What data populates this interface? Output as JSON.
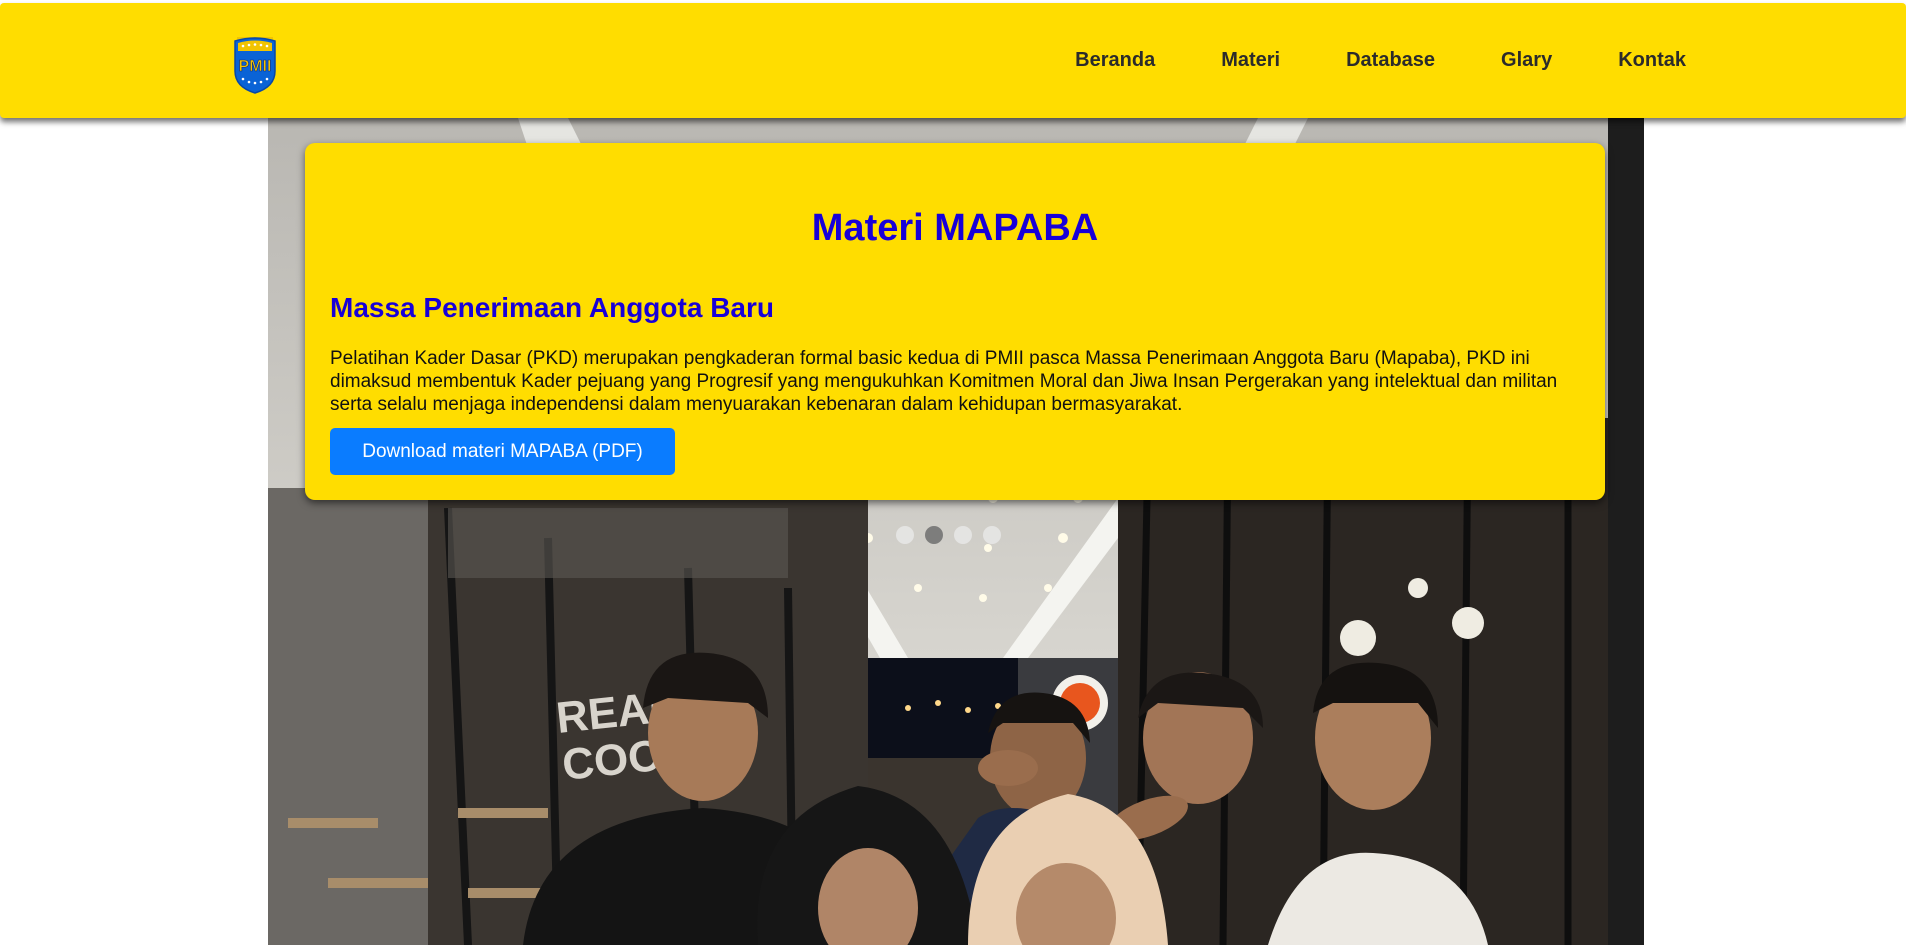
{
  "header": {
    "logo": {
      "text": "PMII",
      "icon": "pmii-shield-logo-icon",
      "color": "#0a63d6"
    },
    "nav": [
      {
        "label": "Beranda"
      },
      {
        "label": "Materi"
      },
      {
        "label": "Database"
      },
      {
        "label": "Glary"
      },
      {
        "label": "Kontak"
      }
    ]
  },
  "card": {
    "title": "Materi MAPABA",
    "subtitle": "Massa Penerimaan Anggota Baru",
    "description": "Pelatihan Kader Dasar (PKD) merupakan pengkaderan formal basic kedua di PMII pasca Massa Penerimaan Anggota Baru (Mapaba), PKD ini dimaksud membentuk Kader pejuang yang Progresif yang mengukuhkan Komitmen Moral dan Jiwa Insan Pergerakan yang intelektual dan militan serta selalu menjaga independensi dalam menyuarakan kebenaran dalam kehidupan bermasyarakat.",
    "download_label": "Download materi MAPABA (PDF)"
  },
  "hero": {
    "sign_text_1": "REAL",
    "sign_text_2": "COO"
  },
  "carousel": {
    "total": 4,
    "active_index": 1
  },
  "colors": {
    "header_bg": "#ffdd00",
    "card_bg": "#ffdd00",
    "title": "#1800d8",
    "button_bg": "#0a7cff"
  }
}
